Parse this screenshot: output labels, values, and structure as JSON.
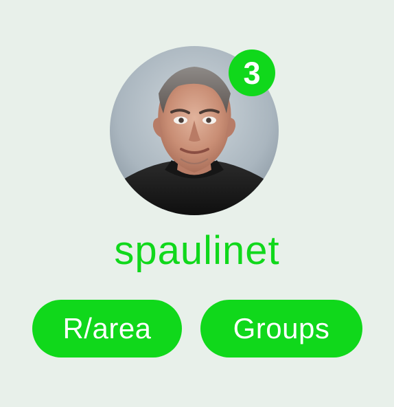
{
  "profile": {
    "username": "spaulinet",
    "notification_count": "3",
    "avatar_icon": "user-photo",
    "accent_color": "#10d81b",
    "background_color": "#e8f0ea",
    "buttons": [
      {
        "label": "R/area"
      },
      {
        "label": "Groups"
      }
    ]
  }
}
